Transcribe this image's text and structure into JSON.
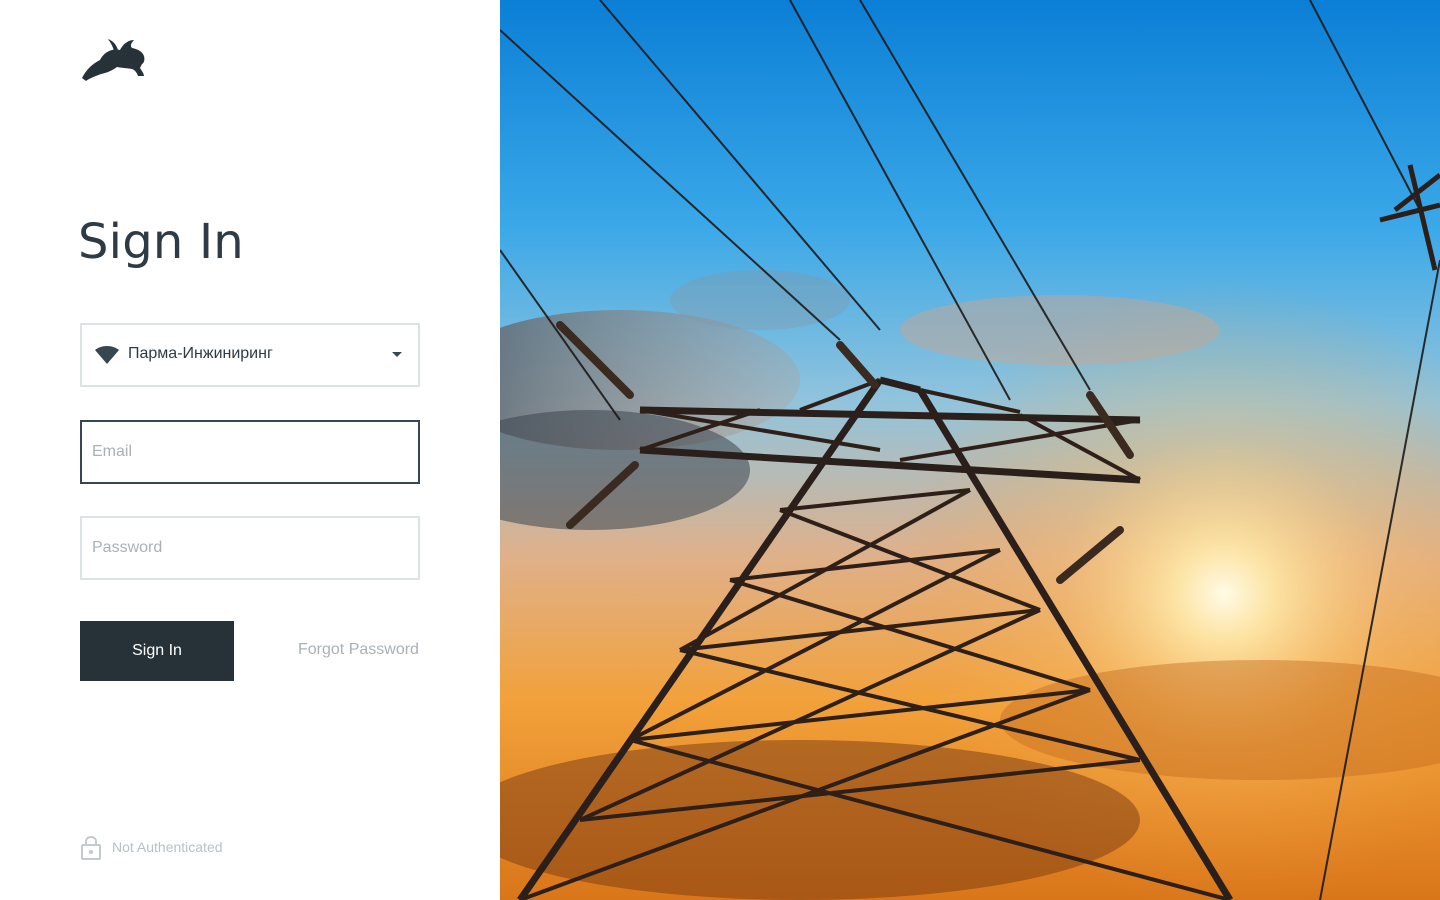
{
  "page": {
    "title": "Sign In"
  },
  "brand": {
    "logo_icon": "leaping-hare-logo",
    "dark_color": "#263238"
  },
  "form": {
    "organization": {
      "icon": "wifi-icon",
      "value": "Парма-Инжиниринг"
    },
    "email": {
      "placeholder": "Email",
      "value": ""
    },
    "password": {
      "placeholder": "Password",
      "value": ""
    },
    "submit_label": "Sign In",
    "forgot_label": "Forgot Password"
  },
  "status": {
    "icon": "lock-icon",
    "text": "Not Authenticated"
  },
  "hero": {
    "subject": "transmission-tower-sunset-image"
  }
}
